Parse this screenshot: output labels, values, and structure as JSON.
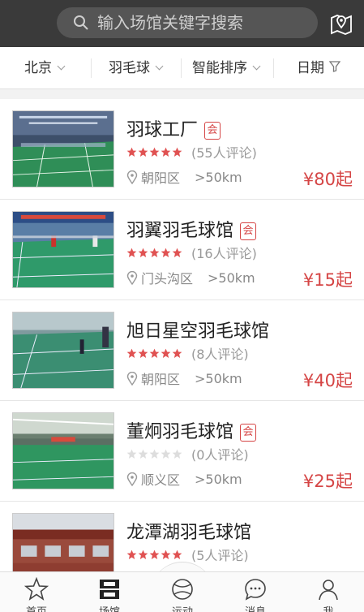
{
  "search": {
    "placeholder": "输入场馆关键字搜索",
    "search_icon": "search-icon",
    "map_icon": "map-pin-icon"
  },
  "filters": [
    {
      "label": "北京",
      "icon": "chevron-down-icon"
    },
    {
      "label": "羽毛球",
      "icon": "chevron-down-icon"
    },
    {
      "label": "智能排序",
      "icon": "chevron-down-icon"
    },
    {
      "label": "日期",
      "icon": "filter-icon"
    }
  ],
  "venues": [
    {
      "name": "羽球工厂",
      "badge": "会",
      "rating": 5,
      "reviews": "(55人评论)",
      "district": "朝阳区",
      "distance": ">50km",
      "price": "¥80起"
    },
    {
      "name": "羽翼羽毛球馆",
      "badge": "会",
      "rating": 5,
      "reviews": "(16人评论)",
      "district": "门头沟区",
      "distance": ">50km",
      "price": "¥15起"
    },
    {
      "name": "旭日星空羽毛球馆",
      "badge": "",
      "rating": 5,
      "reviews": "(8人评论)",
      "district": "朝阳区",
      "distance": ">50km",
      "price": "¥40起"
    },
    {
      "name": "董炯羽毛球馆",
      "badge": "会",
      "rating": 0,
      "reviews": "(0人评论)",
      "district": "顺义区",
      "distance": ">50km",
      "price": "¥25起"
    },
    {
      "name": "龙潭湖羽毛球馆",
      "badge": "",
      "rating": 5,
      "reviews": "(5人评论)",
      "district": "",
      "distance": "",
      "price": ""
    }
  ],
  "tabs": [
    {
      "label": "首页",
      "icon": "star-icon"
    },
    {
      "label": "场馆",
      "icon": "venue-icon"
    },
    {
      "label": "运动",
      "icon": "ball-icon"
    },
    {
      "label": "消息",
      "icon": "message-icon"
    },
    {
      "label": "我",
      "icon": "user-icon"
    }
  ],
  "colors": {
    "header": "#3a3a3a",
    "accent": "#d54545",
    "star": "#e05252",
    "star_empty": "#dddddd"
  }
}
